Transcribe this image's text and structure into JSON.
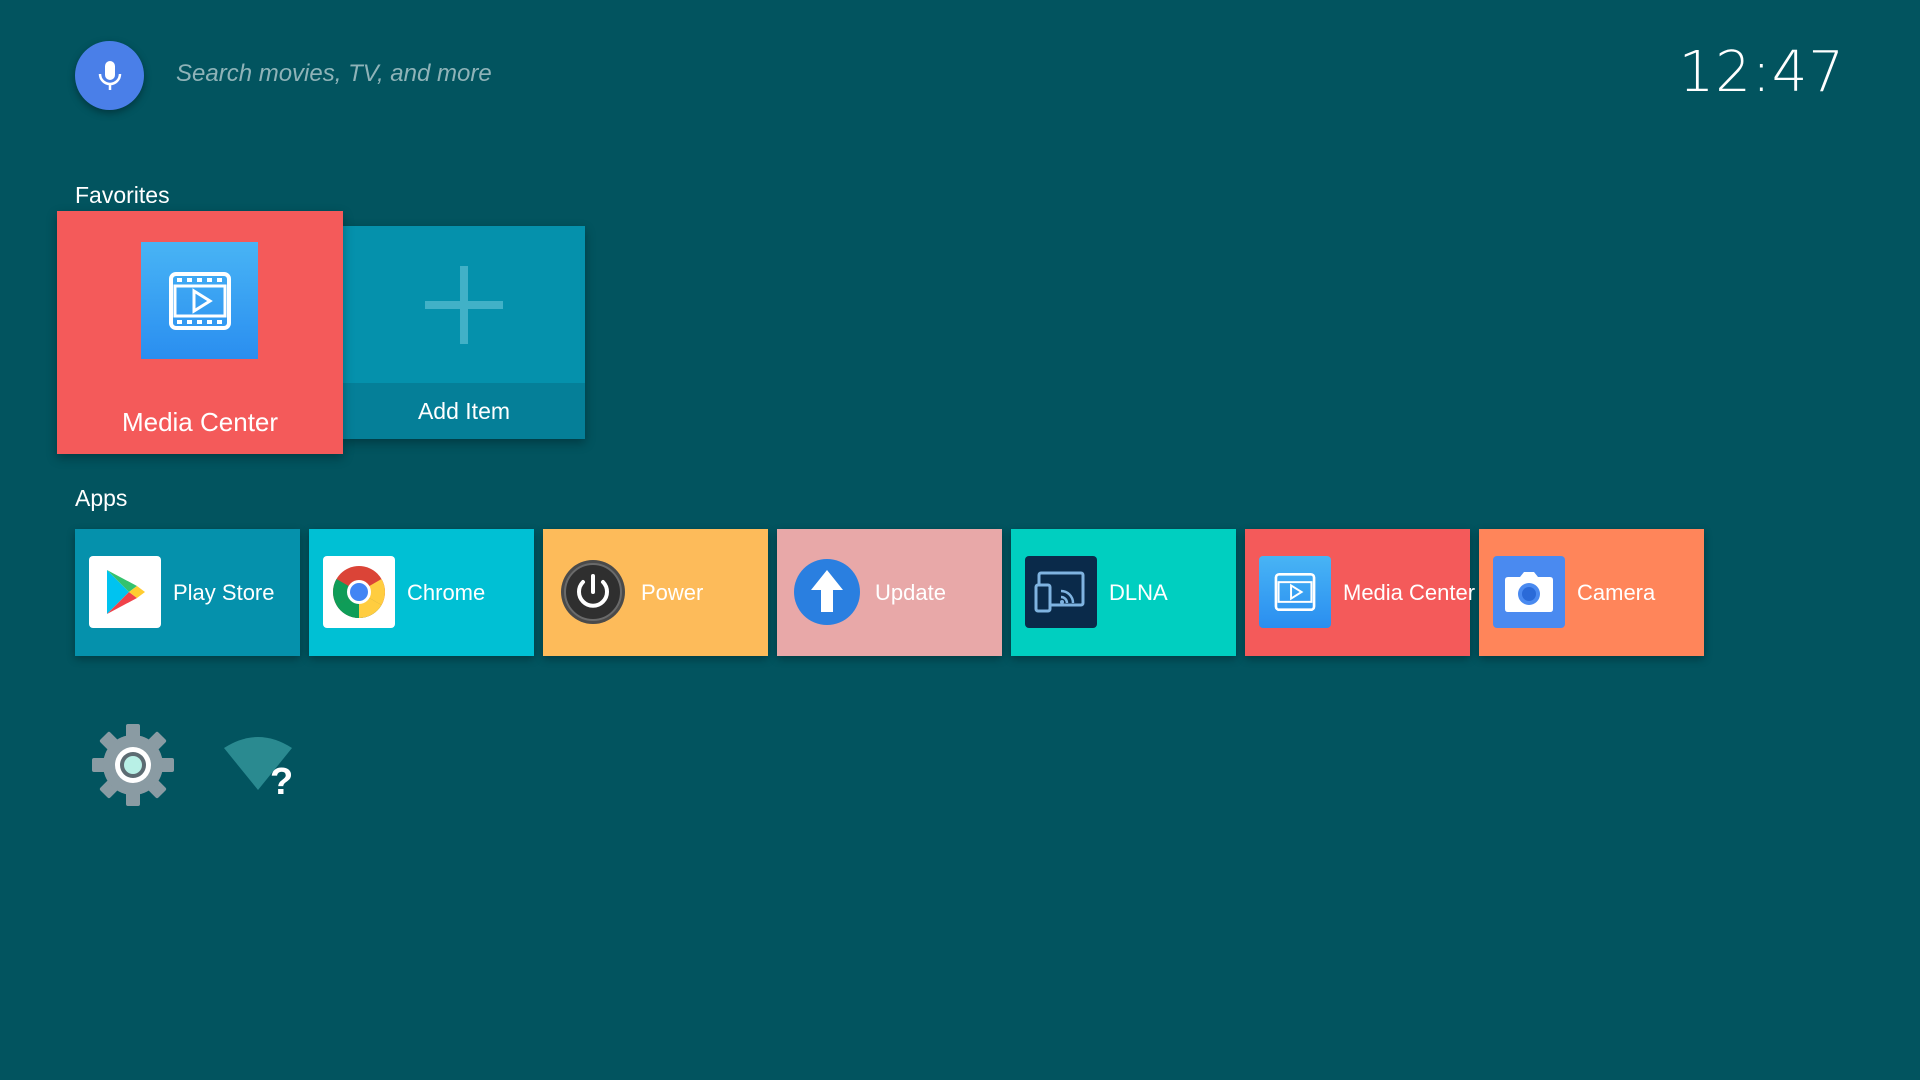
{
  "search": {
    "hint": "Search movies, TV, and more",
    "mic_icon": "microphone-icon"
  },
  "clock": {
    "time": "12:47"
  },
  "favorites": {
    "title": "Favorites",
    "items": [
      {
        "label": "Media Center",
        "icon": "media-center-icon",
        "color": "#f45a5a"
      },
      {
        "label": "Add Item",
        "icon": "plus-icon",
        "color": "#0591ac"
      }
    ]
  },
  "apps": {
    "title": "Apps",
    "items": [
      {
        "label": "Play Store",
        "icon": "play-store-icon",
        "color": "#0591ac"
      },
      {
        "label": "Chrome",
        "icon": "chrome-icon",
        "color": "#00c0d4"
      },
      {
        "label": "Power",
        "icon": "power-icon",
        "color": "#fdbb5a"
      },
      {
        "label": "Update",
        "icon": "update-arrow-icon",
        "color": "#e8a8a8"
      },
      {
        "label": "DLNA",
        "icon": "dlna-cast-icon",
        "color": "#00cfc0"
      },
      {
        "label": "Media Center",
        "icon": "media-center-icon",
        "color": "#f45a5a"
      },
      {
        "label": "Camera",
        "icon": "camera-icon",
        "color": "#ff855a"
      }
    ]
  },
  "system": {
    "settings_icon": "settings-gear-icon",
    "network_icon": "wifi-unknown-icon"
  }
}
